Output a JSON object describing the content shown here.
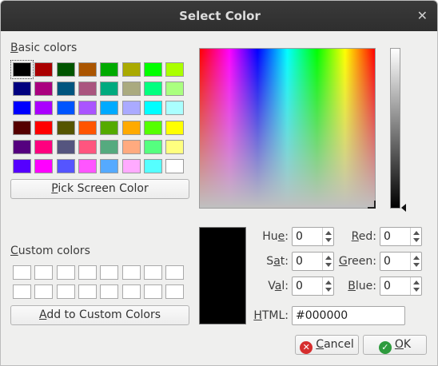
{
  "window": {
    "title": "Select Color",
    "close_glyph": "✕"
  },
  "basic_colors": {
    "label_first": "B",
    "label_rest": "asic colors",
    "rows": [
      [
        "#000000",
        "#aa0000",
        "#005500",
        "#aa5500",
        "#00aa00",
        "#aaaa00",
        "#00ff00",
        "#aaff00"
      ],
      [
        "#00007f",
        "#aa007f",
        "#00557f",
        "#aa557f",
        "#00aa7f",
        "#aaaa7f",
        "#00ff7f",
        "#aaff7f"
      ],
      [
        "#0000ff",
        "#aa00ff",
        "#0055ff",
        "#aa55ff",
        "#00aaff",
        "#aaaaff",
        "#00ffff",
        "#aaffff"
      ],
      [
        "#550000",
        "#ff0000",
        "#555500",
        "#ff5500",
        "#55aa00",
        "#ffaa00",
        "#55ff00",
        "#ffff00"
      ],
      [
        "#55007f",
        "#ff007f",
        "#55557f",
        "#ff557f",
        "#55aa7f",
        "#ffaa7f",
        "#55ff7f",
        "#ffff7f"
      ],
      [
        "#5500ff",
        "#ff00ff",
        "#5555ff",
        "#ff55ff",
        "#55aaff",
        "#ffaaff",
        "#55ffff",
        "#ffffff"
      ]
    ]
  },
  "pick_screen_button": {
    "first": "P",
    "rest": "ick Screen Color"
  },
  "custom_colors": {
    "label_first": "C",
    "label_rest": "ustom colors"
  },
  "add_custom_button": {
    "first": "A",
    "rest": "dd to Custom Colors"
  },
  "fields": {
    "hue": {
      "first": "H",
      "middle": "u",
      "underline": "e",
      "suffix": ":",
      "value": "0"
    },
    "sat": {
      "first": "S",
      "underline": "a",
      "rest": "t:",
      "value": "0"
    },
    "val": {
      "first": "V",
      "underline": "a",
      "rest": "l:",
      "value": "0"
    },
    "red": {
      "underline": "R",
      "rest": "ed:",
      "value": "0"
    },
    "green": {
      "underline": "G",
      "rest": "reen:",
      "value": "0"
    },
    "blue": {
      "underline": "B",
      "rest": "lue:",
      "value": "0"
    },
    "html": {
      "underline": "H",
      "rest": "TML:",
      "value": "#000000"
    }
  },
  "current_color": "#000000",
  "buttons": {
    "cancel": {
      "underline": "C",
      "rest": "ancel",
      "icon": "cancel-icon"
    },
    "ok": {
      "underline": "O",
      "rest": "K",
      "icon": "ok-icon"
    }
  }
}
